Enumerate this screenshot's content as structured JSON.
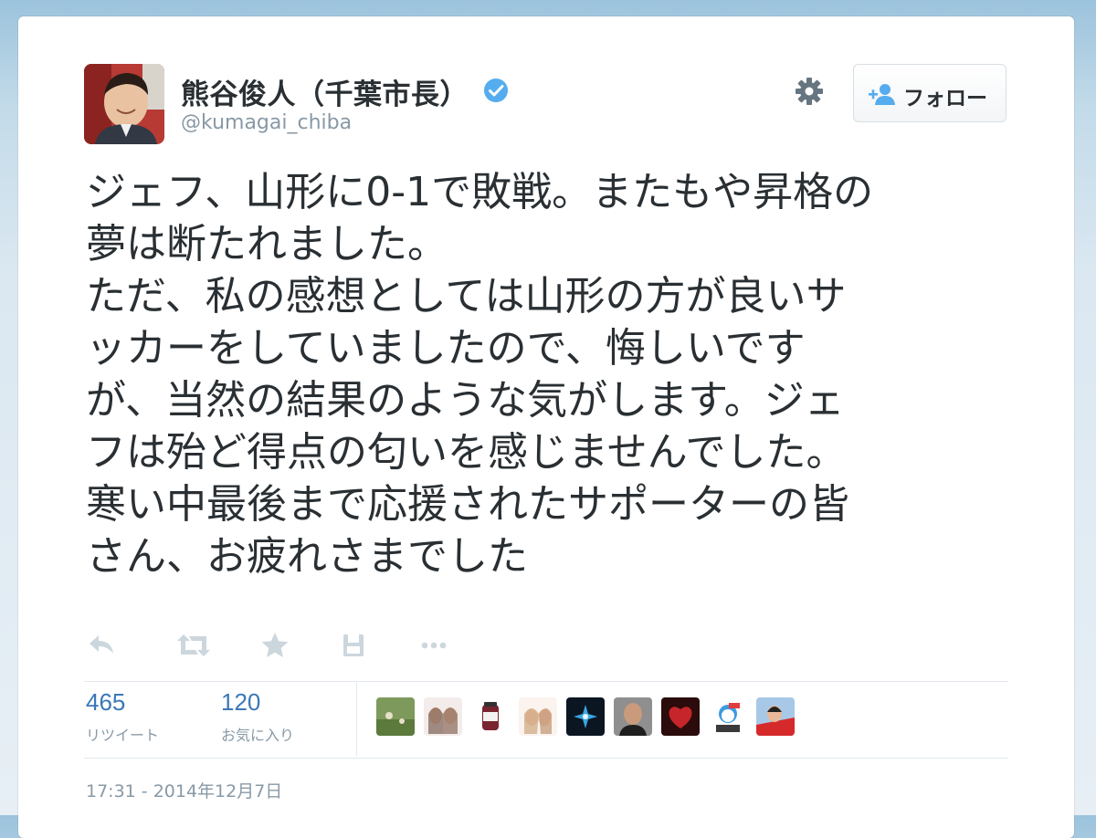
{
  "user": {
    "name": "熊谷俊人（千葉市長）",
    "handle": "@kumagai_chiba",
    "verified": true
  },
  "follow_button": {
    "label": "フォロー"
  },
  "tweet": {
    "lines": [
      "ジェフ、山形に0-1で敗戦。またもや昇格の",
      "夢は断たれました。",
      "ただ、私の感想としては山形の方が良いサ",
      "ッカーをしていましたので、悔しいです",
      "が、当然の結果のような気がします。ジェ",
      "フは殆ど得点の匂いを感じませんでした。",
      "寒い中最後まで応援されたサポーターの皆",
      "さん、お疲れさまでした"
    ]
  },
  "actions": {
    "icons": [
      "reply-icon",
      "retweet-icon",
      "favorite-icon",
      "save-icon",
      "more-icon"
    ]
  },
  "stats": {
    "retweets": {
      "count": "465",
      "label": "リツイート"
    },
    "favorites": {
      "count": "120",
      "label": "お気に入り"
    }
  },
  "timestamp": "17:31 - 2014年12月7日",
  "colors": {
    "link_blue": "#3b78b7",
    "verified_blue": "#55acee",
    "text_dark": "#292f33",
    "text_gray": "#8899a6"
  }
}
